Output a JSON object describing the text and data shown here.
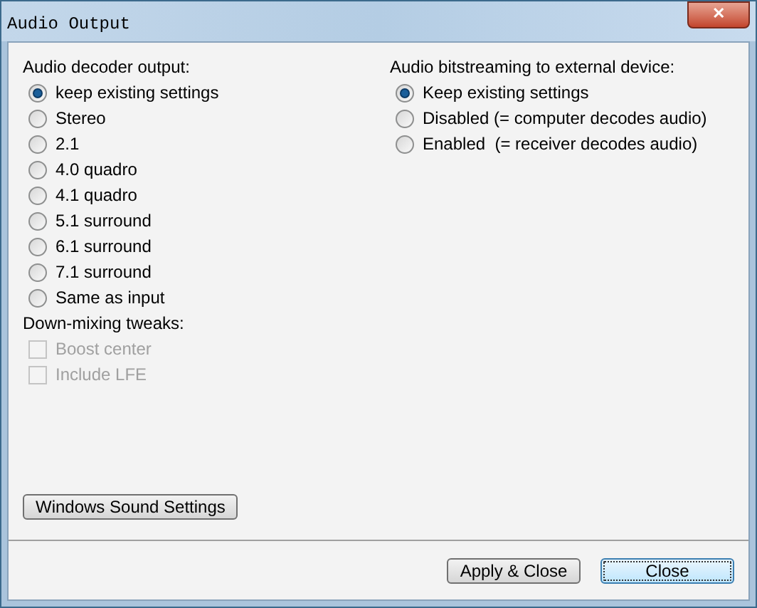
{
  "window": {
    "title": "Audio Output",
    "close_glyph": "✕"
  },
  "decoder": {
    "heading": "Audio decoder output:",
    "options": [
      {
        "label": "keep existing settings",
        "selected": true
      },
      {
        "label": "Stereo",
        "selected": false
      },
      {
        "label": "2.1",
        "selected": false
      },
      {
        "label": "4.0 quadro",
        "selected": false
      },
      {
        "label": "4.1 quadro",
        "selected": false
      },
      {
        "label": "5.1 surround",
        "selected": false
      },
      {
        "label": "6.1 surround",
        "selected": false
      },
      {
        "label": "7.1 surround",
        "selected": false
      },
      {
        "label": "Same as input",
        "selected": false
      }
    ]
  },
  "tweaks": {
    "heading": "Down-mixing tweaks:",
    "options": [
      {
        "label": "Boost center",
        "checked": false,
        "disabled": true
      },
      {
        "label": "Include LFE",
        "checked": false,
        "disabled": true
      }
    ]
  },
  "bitstreaming": {
    "heading": "Audio bitstreaming to external device:",
    "options": [
      {
        "label": "Keep existing settings",
        "selected": true
      },
      {
        "label": "Disabled (= computer decodes audio)",
        "selected": false
      },
      {
        "label": "Enabled  (= receiver decodes audio)",
        "selected": false
      }
    ]
  },
  "sound_settings_button": "Windows Sound Settings",
  "buttons": [
    {
      "label": "Apply & Close",
      "default": false
    },
    {
      "label": "Close",
      "default": true
    }
  ]
}
